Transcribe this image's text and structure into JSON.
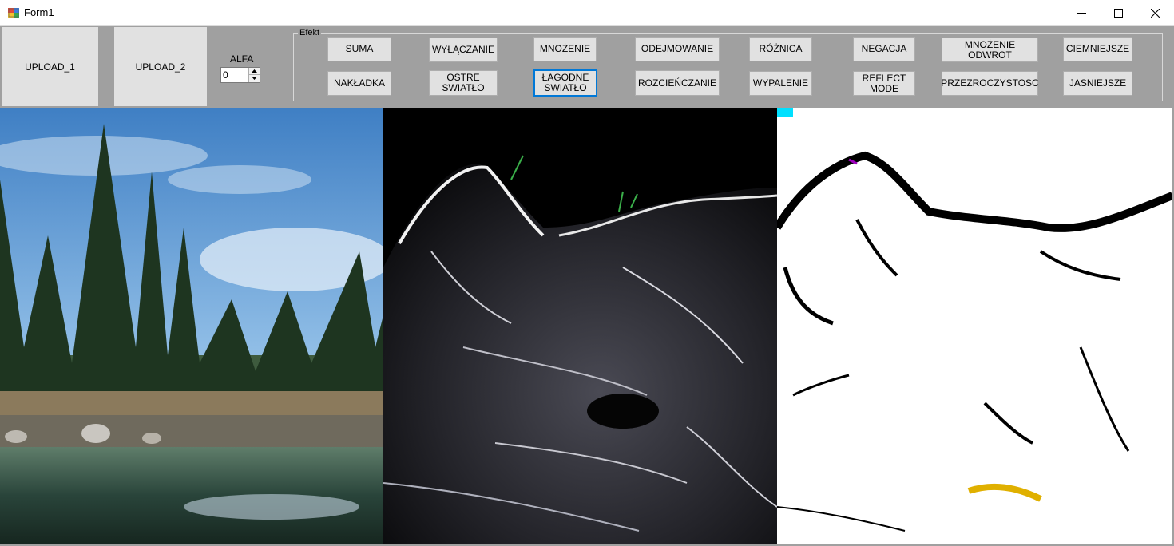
{
  "window": {
    "title": "Form1",
    "minimize_icon": "minimize-icon",
    "maximize_icon": "maximize-icon",
    "close_icon": "close-icon",
    "app_icon": "winforms-app-icon"
  },
  "toolbar": {
    "upload_1": "UPLOAD_1",
    "upload_2": "UPLOAD_2",
    "alfa_label": "ALFA",
    "alfa_value": "0"
  },
  "effects": {
    "group_title": "Efekt",
    "buttons": [
      "SUMA",
      "WYŁĄCZANIE",
      "MNOŻENIE",
      "ODEJMOWANIE",
      "RÓŻNICA",
      "NEGACJA",
      "MNOŻENIE ODWROT",
      "CIEMNIEJSZE",
      "NAKŁADKA",
      "OSTRE\nSWIATŁO",
      "ŁAGODNE\nSWIATŁO",
      "ROZCIEŃCZANIE",
      "WYPALENIE",
      "REFLECT\nMODE",
      "PRZEZROCZYSTOSC",
      "JASNIEJSZE"
    ],
    "focused": "ŁAGODNE\nSWIATŁO"
  },
  "images": [
    "image-1-landscape",
    "image-2-wolf",
    "image-3-result"
  ],
  "colors": {
    "form_background": "#a0a0a0",
    "button_face": "#e1e1e1",
    "focus_border": "#0078d7"
  }
}
